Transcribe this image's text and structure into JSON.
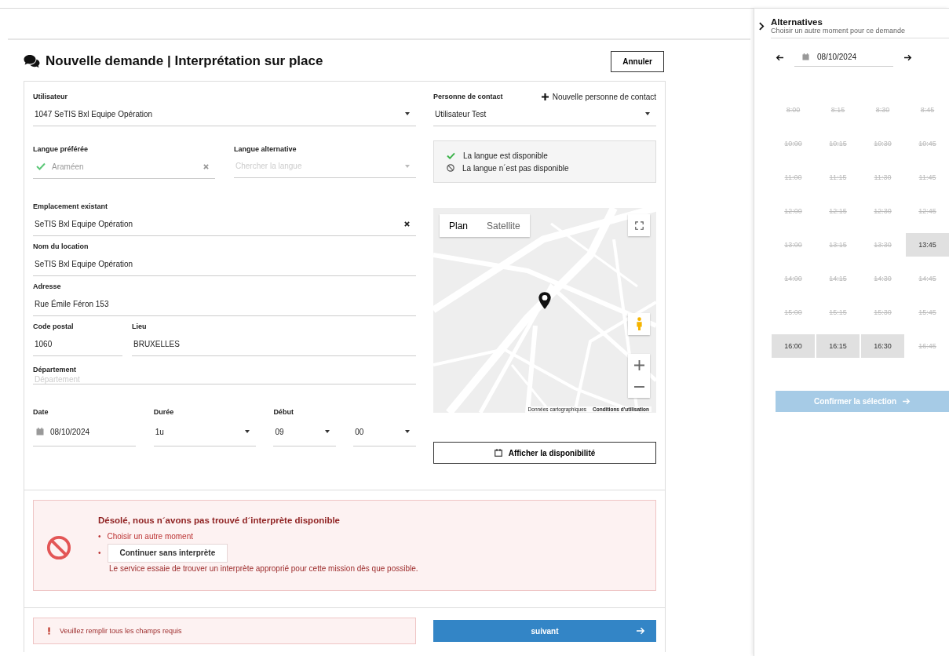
{
  "title": "Nouvelle demande | Interprétation sur place",
  "cancel_button": "Annuler",
  "form": {
    "user": {
      "label": "Utilisateur",
      "value": "1047 SeTIS Bxl Equipe Opération"
    },
    "contact": {
      "label": "Personne de contact",
      "add_link": "Nouvelle personne de contact",
      "value": "Utilisateur Test"
    },
    "preferred_language": {
      "label": "Langue préférée",
      "value": "Araméen",
      "available": true
    },
    "alternative_language": {
      "label": "Langue alternative",
      "placeholder": "Chercher la langue"
    },
    "legend": [
      {
        "kind": "available",
        "text": "La langue est disponible"
      },
      {
        "kind": "unavailable",
        "text": "La langue n´est pas disponible"
      }
    ],
    "existing_location": {
      "label": "Emplacement existant",
      "value": "SeTIS Bxl Equipe Opération"
    },
    "location_name": {
      "label": "Nom du location",
      "value": "SeTIS Bxl Equipe Opération"
    },
    "address": {
      "label": "Adresse",
      "value": "Rue Émile Féron 153"
    },
    "postal_code": {
      "label": "Code postal",
      "value": "1060"
    },
    "city": {
      "label": "Lieu",
      "value": "BRUXELLES"
    },
    "department": {
      "label": "Département",
      "placeholder": "Département"
    },
    "date": {
      "label": "Date",
      "value": "08/10/2024"
    },
    "duration": {
      "label": "Durée",
      "value": "1u"
    },
    "start": {
      "label": "Début",
      "hour": "09",
      "minute": "00"
    },
    "map": {
      "map_types": [
        {
          "label": "Plan",
          "selected": true
        },
        {
          "label": "Satellite",
          "selected": false
        }
      ],
      "attribution": [
        "Données cartographiques",
        "Conditions d'utilisation"
      ]
    },
    "availability_button": "Afficher la disponibilité"
  },
  "alert": {
    "title": "Désolé, nous n´avons pas trouvé d´interprète disponible",
    "options": [
      {
        "kind": "text",
        "bullet": "•",
        "text": "Choisir un autre moment"
      },
      {
        "kind": "button",
        "bullet": "•",
        "text": "Continuer sans interprète"
      }
    ],
    "note": "Le service essaie de trouver un interprète approprié pour cette mission dès que possible."
  },
  "validation_message": "Veuillez remplir tous les champs requis",
  "next_button": "suivant",
  "alternatives": {
    "title": "Alternatives",
    "subtitle": "Choisir un autre moment pour ce demande",
    "date": "08/10/2024",
    "slots": [
      {
        "time": "8:00",
        "available": false
      },
      {
        "time": "8:15",
        "available": false
      },
      {
        "time": "8:30",
        "available": false
      },
      {
        "time": "8:45",
        "available": false
      },
      {
        "time": "10:00",
        "available": false
      },
      {
        "time": "10:15",
        "available": false
      },
      {
        "time": "10:30",
        "available": false
      },
      {
        "time": "10:45",
        "available": false
      },
      {
        "time": "11:00",
        "available": false
      },
      {
        "time": "11:15",
        "available": false
      },
      {
        "time": "11:30",
        "available": false
      },
      {
        "time": "11:45",
        "available": false
      },
      {
        "time": "12:00",
        "available": false
      },
      {
        "time": "12:15",
        "available": false
      },
      {
        "time": "12:30",
        "available": false
      },
      {
        "time": "12:45",
        "available": false
      },
      {
        "time": "13:00",
        "available": false
      },
      {
        "time": "13:15",
        "available": false
      },
      {
        "time": "13:30",
        "available": false
      },
      {
        "time": "13:45",
        "available": true
      },
      {
        "time": "14:00",
        "available": false
      },
      {
        "time": "14:15",
        "available": false
      },
      {
        "time": "14:30",
        "available": false
      },
      {
        "time": "14:45",
        "available": false
      },
      {
        "time": "15:00",
        "available": false
      },
      {
        "time": "15:15",
        "available": false
      },
      {
        "time": "15:30",
        "available": false
      },
      {
        "time": "15:45",
        "available": false
      },
      {
        "time": "16:00",
        "available": true
      },
      {
        "time": "16:15",
        "available": true
      },
      {
        "time": "16:30",
        "available": true
      },
      {
        "time": "16:45",
        "available": false
      }
    ],
    "confirm_button": {
      "label": "Confirmer la sélection",
      "disabled": true
    }
  }
}
